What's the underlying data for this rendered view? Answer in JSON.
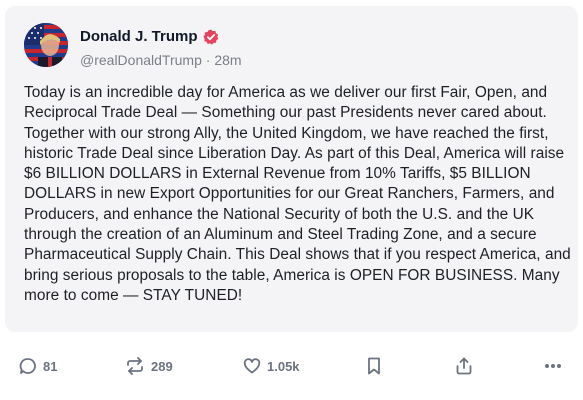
{
  "post": {
    "author_name": "Donald J. Trump",
    "handle": "@realDonaldTrump",
    "separator": "·",
    "time_ago": "28m",
    "text": "Today is an incredible day for America as we deliver our first Fair, Open, and Reciprocal Trade Deal — Something our past Presidents never cared about. Together with our strong Ally, the United Kingdom, we have reached the first, historic Trade Deal since Liberation Day. As part of this Deal, America will raise $6 BILLION DOLLARS in External Revenue from 10% Tariffs, $5 BILLION DOLLARS in new Export Opportunities for our Great Ranchers, Farmers, and Producers, and enhance the National Security of both the U.S. and the UK through the creation of an Aluminum and Steel Trading Zone, and a secure Pharmaceutical Supply Chain. This Deal shows that if you respect America, and bring serious proposals to the table, America is OPEN FOR BUSINESS. Many more to come — STAY TUNED!"
  },
  "actions": {
    "replies": "81",
    "reposts": "289",
    "likes": "1.05k"
  },
  "icons": {
    "verified": "verified-badge-icon",
    "reply": "reply-icon",
    "repost": "repost-icon",
    "like": "heart-icon",
    "bookmark": "bookmark-icon",
    "share": "share-icon",
    "more": "more-icon"
  },
  "colors": {
    "verified_badge": "#e8425e",
    "card_background": "#f4f4f6",
    "icon_gray": "#6b7280"
  }
}
